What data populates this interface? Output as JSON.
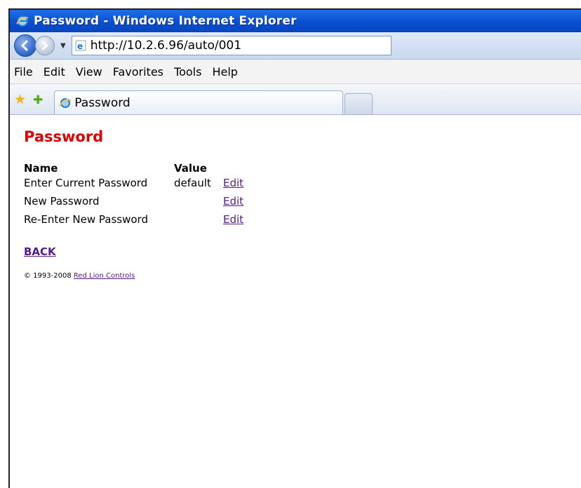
{
  "window": {
    "title": "Password - Windows Internet Explorer"
  },
  "address": {
    "url": "http://10.2.6.96/auto/001"
  },
  "menu": {
    "items": [
      "File",
      "Edit",
      "View",
      "Favorites",
      "Tools",
      "Help"
    ]
  },
  "tab": {
    "label": "Password"
  },
  "page": {
    "title": "Password",
    "table": {
      "headers": {
        "name": "Name",
        "value": "Value"
      },
      "rows": [
        {
          "name": "Enter Current Password",
          "value": "default",
          "action": "Edit"
        },
        {
          "name": "New Password",
          "value": "",
          "action": "Edit"
        },
        {
          "name": "Re-Enter New Password",
          "value": "",
          "action": "Edit"
        }
      ]
    },
    "back_label": "BACK",
    "footer": {
      "copyright": "© 1993-2008 ",
      "company": "Red Lion Controls"
    }
  },
  "colors": {
    "title_red": "#e00000",
    "link_purple": "#551a8b",
    "titlebar_blue": "#0a4fd0"
  },
  "icons": [
    "ie-icon",
    "back-arrow-icon",
    "forward-arrow-icon",
    "dropdown-caret-icon",
    "favorites-star-icon",
    "add-favorite-icon"
  ]
}
